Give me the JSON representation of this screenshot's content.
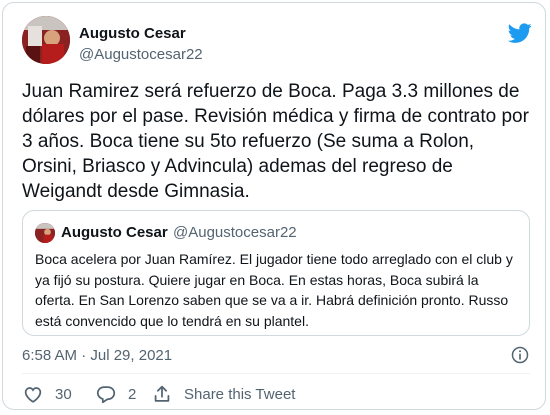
{
  "author": {
    "name": "Augusto Cesar",
    "handle": "@Augustocesar22"
  },
  "tweet": {
    "text": "Juan Ramirez será refuerzo de Boca. Paga 3.3 millones de dólares por el pase. Revisión médica y firma de contrato por 3 años. Boca tiene su 5to refuerzo (Se suma a Rolon, Orsini, Briasco y Advincula) ademas del regreso de Weigandt desde Gimnasia.",
    "timestamp": "6:58 AM · Jul 29, 2021"
  },
  "quoted": {
    "name": "Augusto Cesar",
    "handle": "@Augustocesar22",
    "text": "Boca acelera por Juan Ramírez. El jugador tiene todo arreglado con el club y ya fijó su postura. Quiere jugar en Boca. En estas horas, Boca subirá la oferta. En San Lorenzo saben que se va a ir. Habrá definición pronto. Russo está convencido que lo tendrá en su plantel."
  },
  "actions": {
    "likes": "30",
    "replies": "2",
    "share_label": "Share this Tweet"
  },
  "icons": {
    "brand": "twitter-bird-icon",
    "like": "heart-icon",
    "reply": "reply-bubble-icon",
    "share": "share-icon",
    "info": "info-icon"
  },
  "colors": {
    "brand": "#1d9bf0",
    "text": "#0f1419",
    "muted": "#536471",
    "border": "#cfd9de"
  }
}
